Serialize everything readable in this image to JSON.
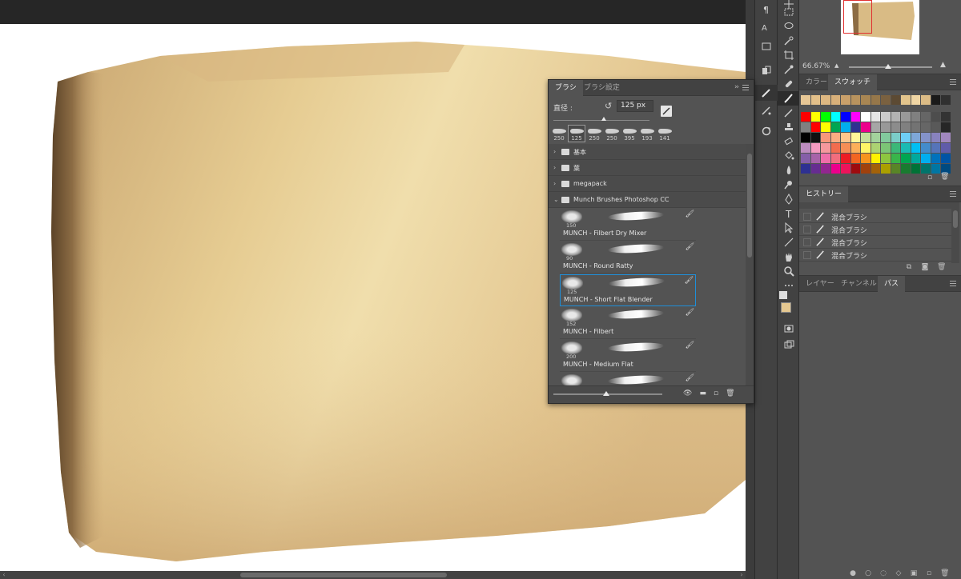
{
  "canvas": {
    "paint_light": "#ecd9a2",
    "paint_dark": "#6a5233",
    "paint_mid": "#d4b27a"
  },
  "toolbar": {
    "tools": [
      "move-tool",
      "marquee-tool",
      "lasso-tool",
      "quick-select-tool",
      "crop-tool",
      "eyedropper-tool",
      "healing-tool",
      "mixer-brush-tool",
      "clone-stamp-tool",
      "history-brush-tool",
      "eraser-tool",
      "paint-bucket-tool",
      "blur-tool",
      "dodge-tool",
      "pen-tool",
      "text-tool",
      "path-select-tool",
      "line-tool",
      "hand-tool",
      "zoom-tool",
      "more-tools",
      "color-swatch",
      "quick-mask",
      "screen-mode"
    ]
  },
  "navigator": {
    "zoom": "66.67%"
  },
  "swatches_panel": {
    "tab_color": "カラー",
    "tab_swatches": "スウォッチ"
  },
  "history_panel": {
    "tab": "ヒストリー",
    "items": [
      "混合ブラシ",
      "混合ブラシ",
      "混合ブラシ",
      "混合ブラシ"
    ]
  },
  "layers_panel": {
    "tab_layers": "レイヤー",
    "tab_channels": "チャンネル",
    "tab_paths": "パス"
  },
  "brush_panel": {
    "tab_brush": "ブラシ",
    "tab_brush_settings": "ブラシ設定",
    "size_label": "直径 :",
    "size_value": "125 px",
    "presets": [
      "250",
      "125",
      "250",
      "250",
      "395",
      "193",
      "141"
    ],
    "folders": [
      "基本",
      "葉",
      "megapack",
      "Munch Brushes Photoshop CC"
    ],
    "brushes": [
      {
        "size": "150",
        "name": "MUNCH - Filbert Dry Mixer"
      },
      {
        "size": "90",
        "name": "MUNCH - Round Ratty"
      },
      {
        "size": "125",
        "name": "MUNCH - Short Flat Blender"
      },
      {
        "size": "152",
        "name": "MUNCH  - Filbert"
      },
      {
        "size": "200",
        "name": "MUNCH - Medium Flat"
      }
    ]
  },
  "colors": {
    "foreground": "#e5c891",
    "background": "#ffffff",
    "swatch_recent": [
      "#e8c896",
      "#e3c08a",
      "#deb882",
      "#d8b07a",
      "#c9a06a",
      "#b8935e",
      "#a88653",
      "#96774a",
      "#7a6140",
      "#5c4a33",
      "#e2c48c",
      "#f0d6a4",
      "#dcbc86",
      "#1a1a1a",
      "#303030",
      "#0060b0"
    ],
    "swatch_rows": [
      [
        "#ff0000",
        "#ffff00",
        "#00ff00",
        "#00ffff",
        "#0000ff",
        "#ff00ff",
        "#ffffff",
        "#e6e6e6",
        "#cccccc",
        "#b3b3b3",
        "#999999",
        "#808080",
        "#666666",
        "#4d4d4d",
        "#333333"
      ],
      [
        "#808080",
        "#ff0000",
        "#ffff00",
        "#00a651",
        "#00aeef",
        "#2e3192",
        "#ec008c",
        "#a6a6a6",
        "#999999",
        "#8c8c8c",
        "#808080",
        "#737373",
        "#666666",
        "#595959",
        "#262626"
      ],
      [
        "#000000",
        "#111111",
        "#f7977a",
        "#fbad82",
        "#fdc68c",
        "#fff799",
        "#c4df9b",
        "#a3d39c",
        "#82ca9d",
        "#7bcdc8",
        "#6ecff6",
        "#7ea7d8",
        "#8493ca",
        "#8882be",
        "#a187be"
      ],
      [
        "#bc8cbf",
        "#f49bc1",
        "#f5989d",
        "#f26c4f",
        "#f68e56",
        "#fbaf5a",
        "#fff467",
        "#acd372",
        "#7cc576",
        "#3bb878",
        "#1abbb4",
        "#00bff3",
        "#438ccb",
        "#5574b9",
        "#605ca9"
      ],
      [
        "#855fa8",
        "#a763a9",
        "#ef6ea8",
        "#f16d7e",
        "#ed1c24",
        "#f26522",
        "#f7941d",
        "#fff200",
        "#8dc63f",
        "#39b54a",
        "#00a651",
        "#00a99d",
        "#00aeef",
        "#0072bc",
        "#0054a5"
      ],
      [
        "#2e3192",
        "#662d91",
        "#92278f",
        "#ec008c",
        "#ed145b",
        "#9e0b0f",
        "#a0410d",
        "#a36209",
        "#aba000",
        "#598527",
        "#197b30",
        "#007236",
        "#00746b",
        "#0076a3",
        "#004a80"
      ]
    ]
  }
}
